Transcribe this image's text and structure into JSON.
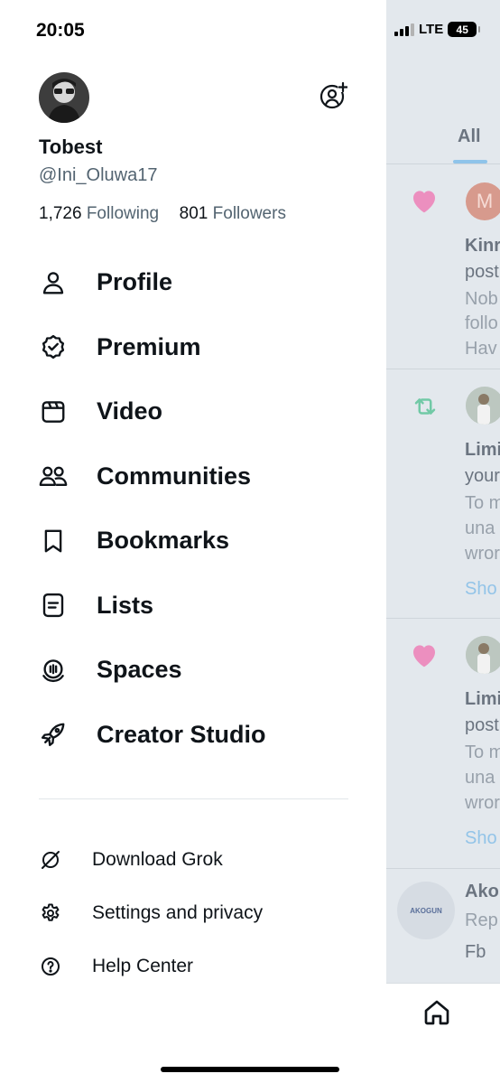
{
  "status_bar": {
    "time": "20:05",
    "network": "LTE",
    "battery": "45"
  },
  "profile": {
    "name": "Tobest",
    "handle": "@Ini_Oluwa17",
    "following_count": "1,726",
    "following_label": "Following",
    "followers_count": "801",
    "followers_label": "Followers"
  },
  "menu": [
    {
      "label": "Profile",
      "icon": "person-icon"
    },
    {
      "label": "Premium",
      "icon": "verified-badge-icon"
    },
    {
      "label": "Video",
      "icon": "video-icon"
    },
    {
      "label": "Communities",
      "icon": "communities-icon"
    },
    {
      "label": "Bookmarks",
      "icon": "bookmark-icon"
    },
    {
      "label": "Lists",
      "icon": "lists-icon"
    },
    {
      "label": "Spaces",
      "icon": "spaces-icon"
    },
    {
      "label": "Creator Studio",
      "icon": "rocket-icon"
    }
  ],
  "secondary": [
    {
      "label": "Download Grok",
      "icon": "grok-icon"
    },
    {
      "label": "Settings and privacy",
      "icon": "gear-icon"
    },
    {
      "label": "Help Center",
      "icon": "help-icon"
    }
  ],
  "background_feed": {
    "tab_all": "All",
    "notif1": {
      "avatar_letter": "M",
      "line1": "Kinr",
      "line2": "post",
      "line3": "Nob",
      "line4": "follo",
      "line5": "Hav"
    },
    "notif2": {
      "line1": "Limi",
      "line2": "your",
      "line3": "To m",
      "line4": "una",
      "line5": "wror",
      "show": "Sho"
    },
    "notif3": {
      "line1": "Limi",
      "line2": "post",
      "line3": "To m",
      "line4": "una",
      "line5": "wror",
      "show": "Sho"
    },
    "post": {
      "author": "Ako",
      "line2": "Rep",
      "line3": "Fb",
      "avatar_text": "AKOGUN"
    }
  },
  "colors": {
    "accent": "#1d9bf0",
    "like": "#f91880",
    "retweet": "#00ba7c",
    "text": "#0f1419",
    "muted": "#536471"
  }
}
